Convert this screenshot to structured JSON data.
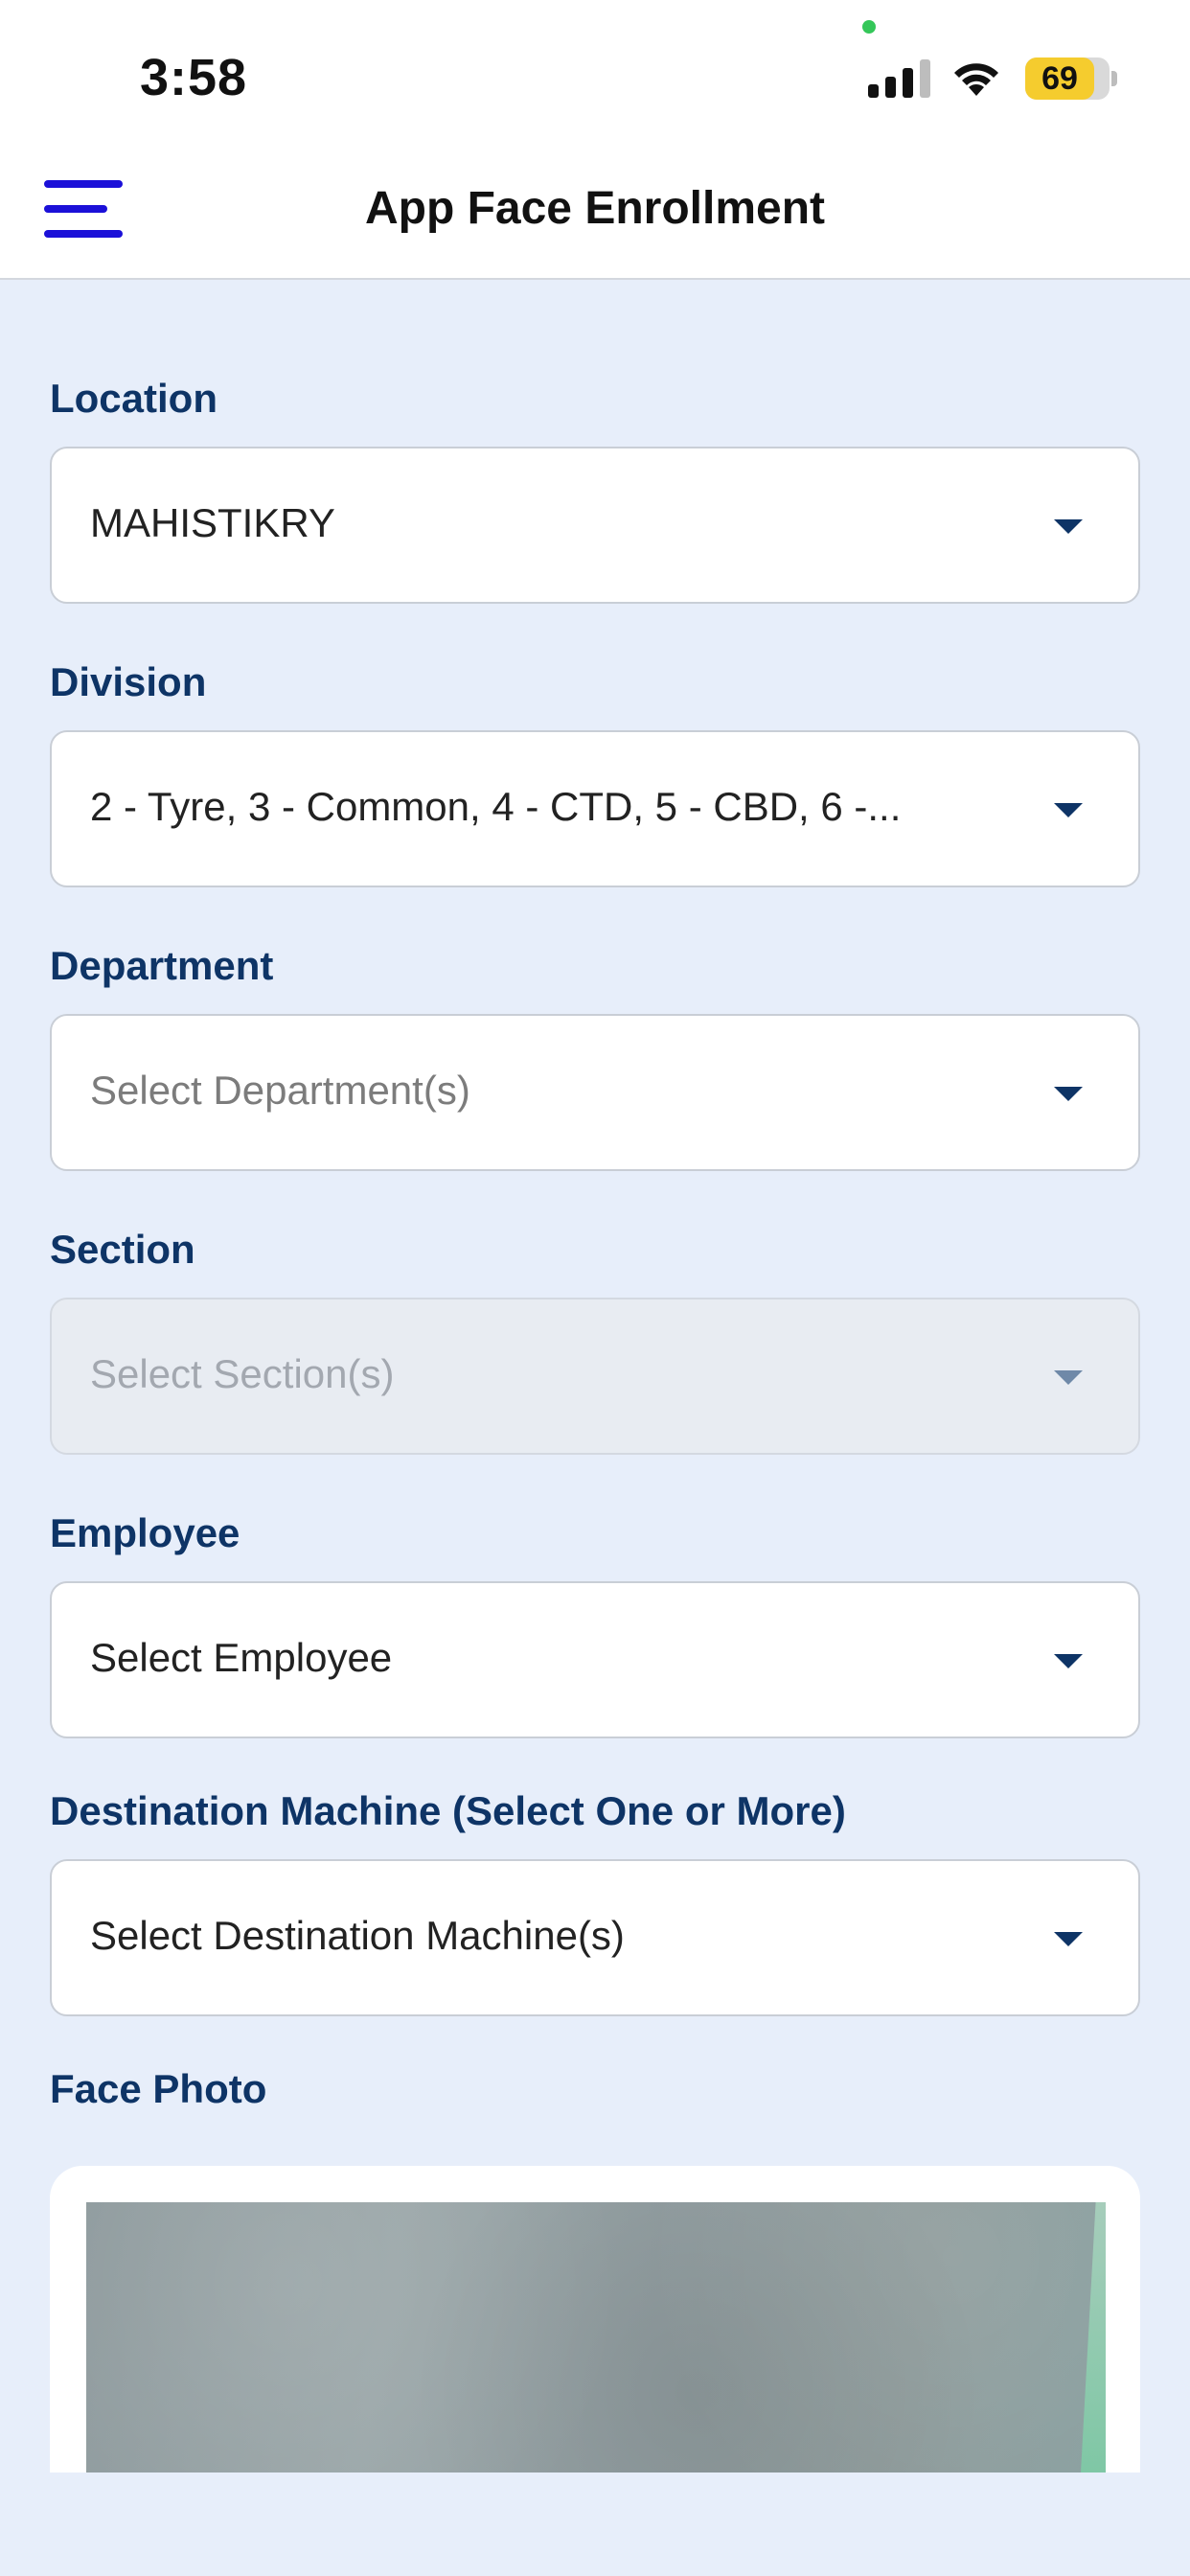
{
  "status_bar": {
    "time": "3:58",
    "battery_percent": "69",
    "battery_level": 0.69,
    "icons": [
      "signal-icon",
      "wifi-icon",
      "battery-icon"
    ]
  },
  "header": {
    "title": "App Face Enrollment",
    "menu_icon": "hamburger-menu-icon",
    "accent_color": "#1b10d8"
  },
  "form": {
    "location": {
      "label": "Location",
      "value": "MAHISTIKRY"
    },
    "division": {
      "label": "Division",
      "value": "2 - Tyre, 3 - Common, 4 - CTD, 5 - CBD, 6 -..."
    },
    "department": {
      "label": "Department",
      "placeholder": "Select Department(s)"
    },
    "section": {
      "label": "Section",
      "placeholder": "Select Section(s)",
      "disabled": true
    },
    "employee": {
      "label": "Employee",
      "placeholder": "Select Employee"
    },
    "destination_machine": {
      "label": "Destination Machine (Select One or More)",
      "placeholder": "Select Destination Machine(s)"
    },
    "face_photo": {
      "label": "Face Photo"
    }
  },
  "colors": {
    "label": "#0e3466",
    "background": "#e7eefa",
    "caret": "#0e3466"
  }
}
